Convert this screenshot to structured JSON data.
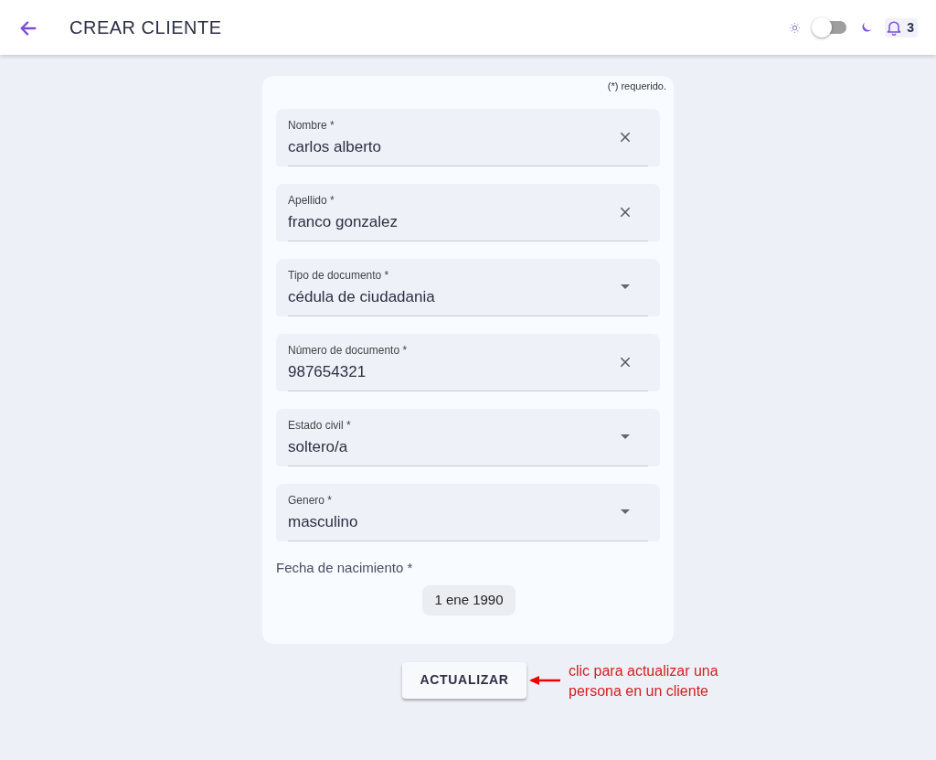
{
  "header": {
    "title": "CREAR CLIENTE",
    "dark_mode": false,
    "notification_count": "3"
  },
  "form": {
    "required_note": "(*) requerido.",
    "fields": [
      {
        "kind": "text",
        "label": "Nombre *",
        "value": "carlos alberto"
      },
      {
        "kind": "text",
        "label": "Apellido *",
        "value": "franco gonzalez"
      },
      {
        "kind": "select",
        "label": "Tipo de documento *",
        "value": "cédula de ciudadania"
      },
      {
        "kind": "text",
        "label": "Número de documento *",
        "value": "987654321"
      },
      {
        "kind": "select",
        "label": "Estado civil *",
        "value": "soltero/a"
      },
      {
        "kind": "select",
        "label": "Genero *",
        "value": "masculino"
      }
    ],
    "date_label": "Fecha de nacimiento *",
    "date_value": "1 ene 1990"
  },
  "submit_button": "ACTUALIZAR",
  "annotation": "clic para actualizar una persona en un cliente"
}
